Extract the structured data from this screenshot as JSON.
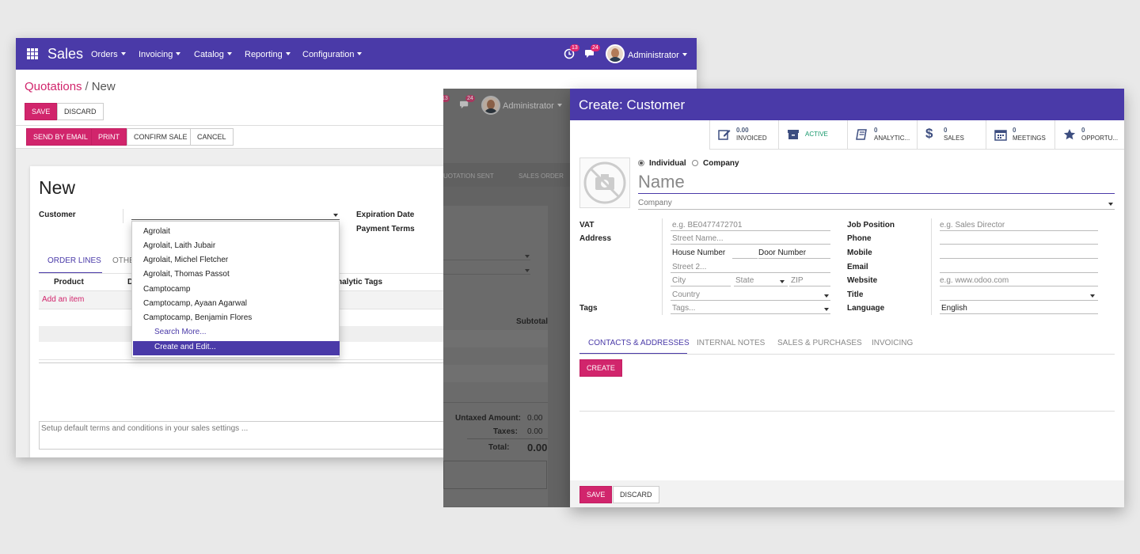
{
  "app": {
    "brand": "Sales",
    "menus": [
      "Orders",
      "Invoicing",
      "Catalog",
      "Reporting",
      "Configuration"
    ],
    "activity_count": "13",
    "messages_count": "24",
    "user": "Administrator"
  },
  "breadcrumb": {
    "parent": "Quotations",
    "separator": "/",
    "current": "New"
  },
  "control_buttons": {
    "save": "SAVE",
    "discard": "DISCARD"
  },
  "status_buttons": {
    "send_email": "SEND BY EMAIL",
    "print": "PRINT",
    "confirm": "CONFIRM SALE",
    "cancel": "CANCEL"
  },
  "form": {
    "title": "New",
    "customer_label": "Customer",
    "expiration_label": "Expiration Date",
    "payment_terms_label": "Payment Terms",
    "tabs": [
      "ORDER LINES",
      "OTHE"
    ],
    "col_product": "Product",
    "col_d": "D",
    "col_analytic": "nalytic Tags",
    "col_subtotal": "Subtotal",
    "add_item": "Add an item",
    "terms_placeholder": "Setup default terms and conditions in your sales settings ..."
  },
  "customer_dropdown": {
    "items": [
      "Agrolait",
      "Agrolait, Laith Jubair",
      "Agrolait, Michel Fletcher",
      "Agrolait, Thomas Passot",
      "Camptocamp",
      "Camptocamp, Ayaan Agarwal",
      "Camptocamp, Benjamin Flores"
    ],
    "search_more": "Search More...",
    "create_edit": "Create and Edit..."
  },
  "overlay": {
    "activity_count": "13",
    "messages_count": "24",
    "user": "Administrator",
    "status_left": "UOTATION SENT",
    "status_right": "SALES ORDER",
    "untaxed_label": "Untaxed Amount:",
    "untaxed_value": "0.00",
    "taxes_label": "Taxes:",
    "taxes_value": "0.00",
    "total_label": "Total:",
    "total_value": "0.00",
    "subtotal": "Subtotal"
  },
  "dialog": {
    "title": "Create: Customer",
    "smart_buttons": [
      {
        "value": "0.00",
        "label": "INVOICED",
        "icon": "edit-icon"
      },
      {
        "value": "",
        "label": "ACTIVE",
        "icon": "archive-icon"
      },
      {
        "value": "0",
        "label": "ANALYTIC...",
        "icon": "book-icon"
      },
      {
        "value": "0",
        "label": "SALES",
        "icon": "dollar-icon"
      },
      {
        "value": "0",
        "label": "MEETINGS",
        "icon": "calendar-icon"
      },
      {
        "value": "0",
        "label": "OPPORTU...",
        "icon": "star-icon"
      }
    ],
    "type_individual": "Individual",
    "type_company": "Company",
    "name_placeholder": "Name",
    "company_placeholder": "Company",
    "left_labels": {
      "vat": "VAT",
      "address": "Address",
      "tags": "Tags"
    },
    "vat_placeholder": "e.g. BE0477472701",
    "street_placeholder": "Street Name...",
    "house_number": "House Number",
    "door_number": "Door Number",
    "street2_placeholder": "Street 2...",
    "city_placeholder": "City",
    "state_placeholder": "State",
    "zip_placeholder": "ZIP",
    "country_placeholder": "Country",
    "tags_placeholder": "Tags...",
    "right_labels": {
      "job": "Job Position",
      "phone": "Phone",
      "mobile": "Mobile",
      "email": "Email",
      "website": "Website",
      "title": "Title",
      "language": "Language"
    },
    "job_placeholder": "e.g. Sales Director",
    "website_placeholder": "e.g. www.odoo.com",
    "language_value": "English",
    "tabs": [
      "CONTACTS & ADDRESSES",
      "INTERNAL NOTES",
      "SALES & PURCHASES",
      "INVOICING"
    ],
    "create_button": "CREATE",
    "save_button": "SAVE",
    "discard_button": "DISCARD"
  },
  "colors": {
    "brand": "#4a3aa8",
    "accent": "#d1256c",
    "active": "#16986b"
  }
}
